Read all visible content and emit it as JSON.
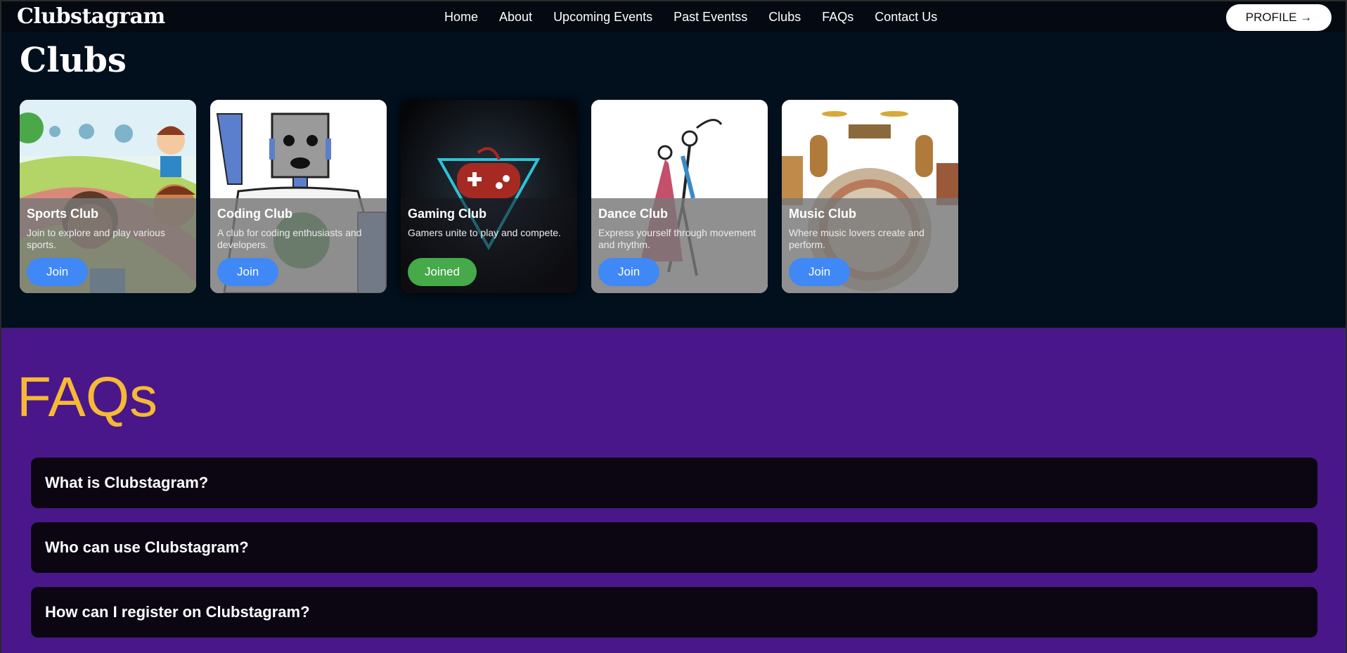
{
  "nav": {
    "brand": "Clubstagram",
    "links": [
      "Home",
      "About",
      "Upcoming Events",
      "Past Eventss",
      "Clubs",
      "FAQs",
      "Contact Us"
    ],
    "profile_label": "PROFILE →"
  },
  "clubs": {
    "title": "Clubs",
    "cards": [
      {
        "title": "Sports Club",
        "description": "Join to explore and play various sports.",
        "button": "Join",
        "art": "kids-running-illustration"
      },
      {
        "title": "Coding Club",
        "description": "A club for coding enthusiasts and developers.",
        "button": "Join",
        "art": "robot-waving-illustration"
      },
      {
        "title": "Gaming Club",
        "description": "Gamers unite to play and compete.",
        "button": "Joined",
        "art": "gaming-controller-logo"
      },
      {
        "title": "Dance Club",
        "description": "Express yourself through movement and rhythm.",
        "button": "Join",
        "art": "dancing-couple-illustration"
      },
      {
        "title": "Music Club",
        "description": "Where music lovers create and perform.",
        "button": "Join",
        "art": "music-instruments-logo"
      }
    ]
  },
  "faq": {
    "title": "FAQs",
    "items": [
      "What is Clubstagram?",
      "Who can use Clubstagram?",
      "How can I register on Clubstagram?"
    ]
  },
  "colors": {
    "nav_bg": "#050a12",
    "clubs_bg": "#020f1c",
    "faq_bg": "#4a178a",
    "faq_title": "#f6b935",
    "join_button": "#3f88f5",
    "joined_button": "#46a94a"
  }
}
